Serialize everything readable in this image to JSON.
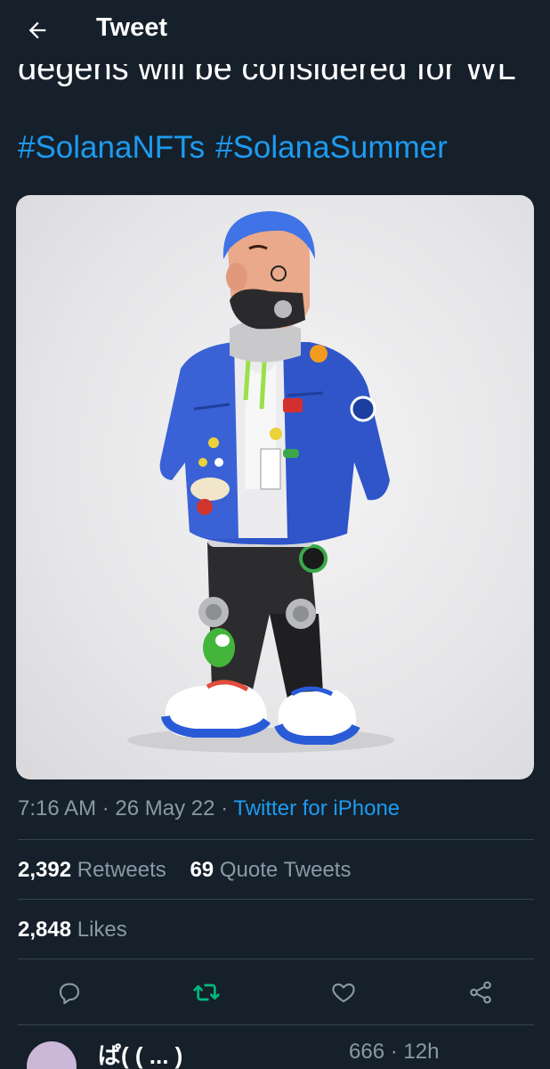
{
  "header": {
    "title": "Tweet",
    "back_icon": "arrow-left-icon"
  },
  "tweet": {
    "text_cut": "degens will be considered for WL",
    "hashtags": [
      "#SolanaNFTs",
      "#SolanaSummer"
    ],
    "image_alt": "3D character figure in blue jacket with patches",
    "time": "7:16 AM",
    "date": "26 May 22",
    "source": "Twitter for iPhone",
    "separator": "·",
    "retweets_count": "2,392",
    "retweets_label": "Retweets",
    "quotes_count": "69",
    "quotes_label": "Quote Tweets",
    "likes_count": "2,848",
    "likes_label": "Likes"
  },
  "actions": [
    {
      "name": "reply",
      "icon": "comment-icon"
    },
    {
      "name": "retweet",
      "icon": "retweet-icon",
      "color": "#00ba7c"
    },
    {
      "name": "like",
      "icon": "heart-icon"
    },
    {
      "name": "share",
      "icon": "share-icon"
    }
  ],
  "reply_preview": {
    "name": "ぱ( ( ... )",
    "meta": "666 · 12h"
  },
  "colors": {
    "background": "#15202b",
    "accent": "#1d9bf0",
    "muted": "#8b98a5",
    "retweet_active": "#00ba7c"
  }
}
